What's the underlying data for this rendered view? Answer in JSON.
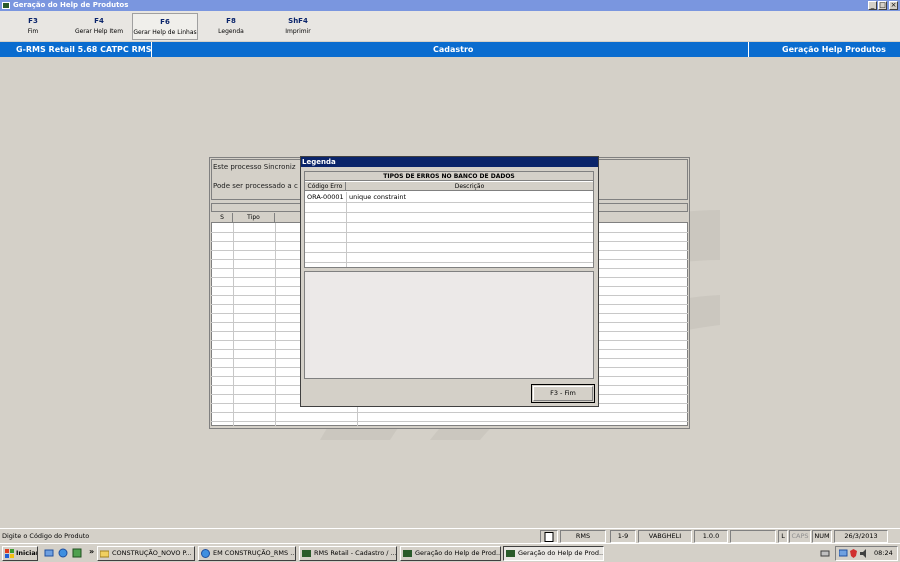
{
  "window": {
    "title": "Geração do Help de Produtos",
    "controls": [
      "_",
      "□",
      "×"
    ]
  },
  "function_keys": [
    {
      "key": "F3",
      "label": "Fim"
    },
    {
      "key": "F4",
      "label": "Gerar Help Item"
    },
    {
      "key": "F6",
      "label": "Gerar Help de Linhas"
    },
    {
      "key": "F8",
      "label": "Legenda"
    },
    {
      "key": "ShF4",
      "label": "Imprimir"
    }
  ],
  "header": {
    "left": "G-RMS Retail 5.68 CATPC RMS",
    "center": "Cadastro",
    "right": "Geração Help Produtos"
  },
  "background_form": {
    "line1": "Este processo Sincroniz",
    "line2": "Pode ser processado a c",
    "grid_columns": [
      "S",
      "Tipo"
    ]
  },
  "legend_dialog": {
    "title": "Legenda",
    "table_title": "TIPOS DE ERROS NO BANCO DE DADOS",
    "columns": [
      "Código Erro",
      "Descrição"
    ],
    "rows": [
      {
        "code": "ORA-00001",
        "description": "unique constraint"
      }
    ],
    "close_button": "F3 - Fim"
  },
  "status_bar": {
    "message": "Digite o Código do Produto",
    "system": "RMS",
    "range": "1-9",
    "user": "VABGHELI",
    "version": "1.0.0",
    "l": "L",
    "caps": "CAPS",
    "num": "NUM",
    "date": "26/3/2013"
  },
  "taskbar": {
    "start": "Iniciar",
    "overflow": "»",
    "items": [
      {
        "label": "CONSTRUÇÃO_NOVO P...",
        "icon": "folder-icon"
      },
      {
        "label": "EM CONSTRUÇÃO_RMS ...",
        "icon": "browser-icon"
      },
      {
        "label": "RMS Retail - Cadastro / ...",
        "icon": "rms-app-icon"
      },
      {
        "label": "Geração do Help de Prod...",
        "icon": "rms-app-icon"
      },
      {
        "label": "Geração do Help de Prod...",
        "icon": "rms-app-icon"
      }
    ],
    "clock": "08:24"
  },
  "colors": {
    "header_blue": "#0a6ccf",
    "dialog_title": "#0a246a",
    "titlebar": "#7a96df",
    "surface": "#d4d0c8"
  }
}
